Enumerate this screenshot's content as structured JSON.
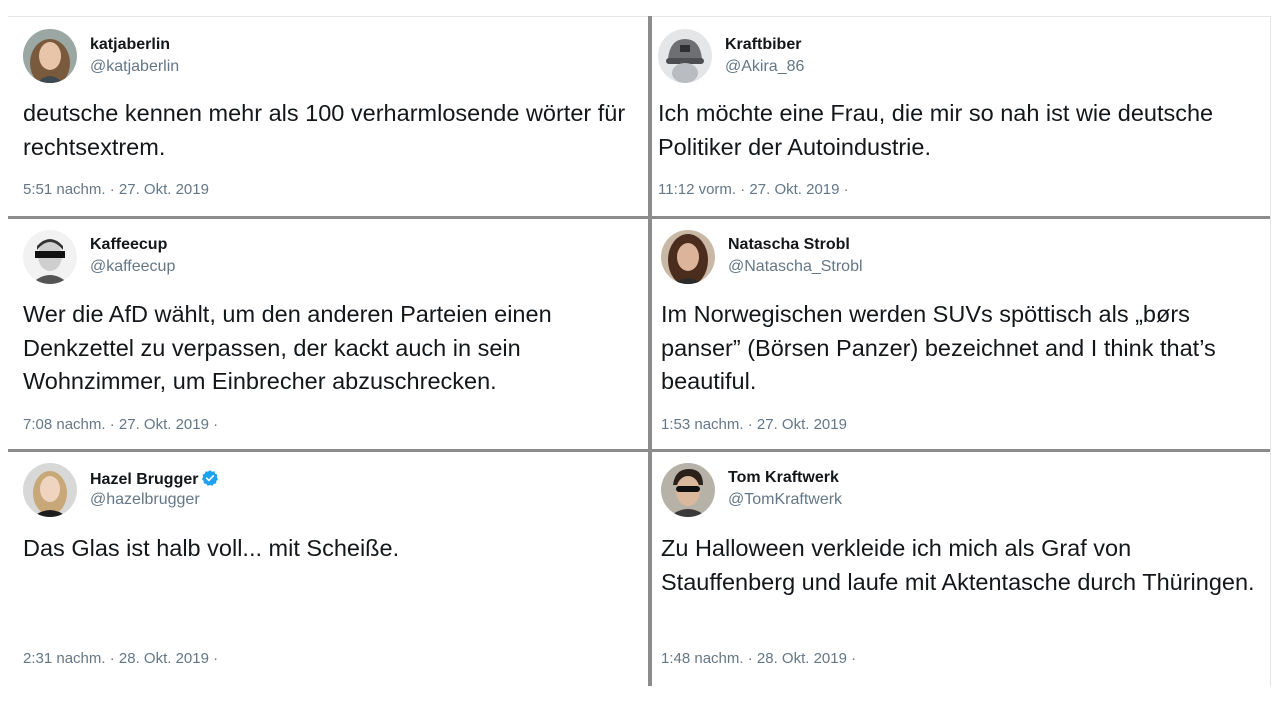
{
  "tweets": [
    {
      "name": "katjaberlin",
      "handle": "@katjaberlin",
      "text": "deutsche kennen mehr als 100 verharmlosende wörter für rechtsextrem.",
      "time": "5:51 nachm. · 27. Okt. 2019",
      "avatar_icon": "woman-portrait-avatar",
      "verified": false
    },
    {
      "name": "Kraftbiber",
      "handle": "@Akira_86",
      "text": "Ich möchte eine Frau, die mir so nah ist wie deutsche Politiker der Autoindustrie.",
      "time": "11:12 vorm. · 27. Okt. 2019 ·",
      "avatar_icon": "cap-avatar",
      "verified": false
    },
    {
      "name": "Kaffeecup",
      "handle": "@kaffeecup",
      "text": "Wer die AfD wählt, um den anderen Parteien einen Denkzettel zu verpassen, der kackt auch in sein Wohnzimmer, um Einbrecher abzuschrecken.",
      "time": "7:08 nachm. · 27. Okt. 2019 ·",
      "avatar_icon": "man-censored-eyes-avatar",
      "verified": false
    },
    {
      "name": "Natascha Strobl",
      "handle": "@Natascha_Strobl",
      "text": "Im Norwegischen werden SUVs spöttisch als „børs panser” (Börsen Panzer) bezeichnet and I think that’s beautiful.",
      "time": "1:53 nachm. · 27. Okt. 2019",
      "avatar_icon": "woman-dark-hair-avatar",
      "verified": false
    },
    {
      "name": "Hazel Brugger",
      "handle": "@hazelbrugger",
      "text": "Das Glas ist halb voll... mit Scheiße.",
      "time": "2:31 nachm. · 28. Okt. 2019 ·",
      "avatar_icon": "woman-blonde-avatar",
      "verified": true
    },
    {
      "name": "Tom Kraftwerk",
      "handle": "@TomKraftwerk",
      "text": "Zu Halloween verkleide ich mich als Graf von Stauffenberg und laufe mit Aktentasche durch Thüringen.",
      "time": "1:48 nachm. · 28. Okt. 2019 ·",
      "avatar_icon": "man-sunglasses-avatar",
      "verified": false
    }
  ],
  "colors": {
    "text": "#14171a",
    "muted": "#657786",
    "verified": "#1da1f2",
    "divider": "#8c8c8c"
  }
}
